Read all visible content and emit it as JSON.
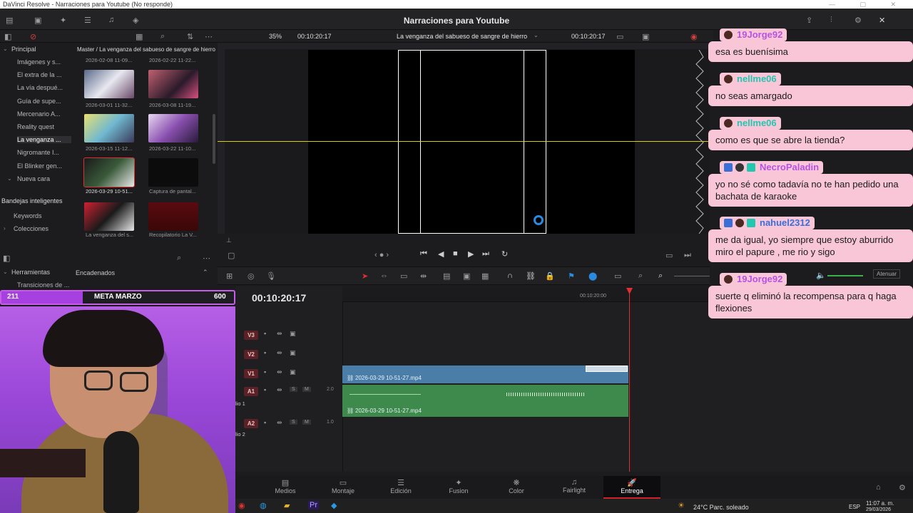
{
  "window": {
    "title": "DaVinci Resolve - Narraciones para Youtube (No responde)"
  },
  "appbar": {
    "project_title": "Narraciones para Youtube"
  },
  "viewer_bar": {
    "zoom": "35%",
    "timecode_left": "00:10:20:17",
    "clip_title": "La venganza del sabueso de sangre de hierro",
    "timecode_right": "00:10:20:17"
  },
  "sidebar": {
    "header": "Principal",
    "items": [
      {
        "label": "Imágenes y s..."
      },
      {
        "label": "El extra de la ..."
      },
      {
        "label": "La vía despué..."
      },
      {
        "label": "Guía de supe..."
      },
      {
        "label": "Mercenario A..."
      },
      {
        "label": "Reality quest"
      },
      {
        "label": "La venganza ..."
      },
      {
        "label": "Nigromante I..."
      },
      {
        "label": "El Blinker gen..."
      },
      {
        "label": "Nueva cara"
      }
    ],
    "smart_bins_header": "Bandejas inteligentes",
    "smart_bins": [
      {
        "label": "Keywords"
      },
      {
        "label": "Colecciones"
      }
    ]
  },
  "media_pool": {
    "path": "Master / La venganza del sabueso de sangre de hierro",
    "thumbnails": [
      {
        "caption": "2026-02-08 11-09..."
      },
      {
        "caption": "2026-02-22 11-22..."
      },
      {
        "caption": "2026-03-01 11-32..."
      },
      {
        "caption": "2026-03-08 11-19..."
      },
      {
        "caption": "2026-03-15 11-12..."
      },
      {
        "caption": "2026-03-22 11-10..."
      },
      {
        "caption": "2026-03-29 10-51..."
      },
      {
        "caption": "Captura de pantal..."
      },
      {
        "caption": "La venganza del s..."
      },
      {
        "caption": "Recopilatorio La V..."
      }
    ]
  },
  "lower_left": {
    "herramientas": "Herramientas",
    "transiciones": "Transiciones de ...",
    "encadenados": "Encadenados"
  },
  "goal": {
    "current": "211",
    "label": "META MARZO",
    "target": "600",
    "fraction": 0.35
  },
  "timeline": {
    "timecode": "00:10:20:17",
    "ruler_mark": "00:10:20:00",
    "tracks": [
      {
        "id": "V3"
      },
      {
        "id": "V2"
      },
      {
        "id": "V1"
      },
      {
        "id": "A1",
        "level": "2.0",
        "name": "lio 1"
      },
      {
        "id": "A2",
        "level": "1.0",
        "name": "lio 2"
      }
    ],
    "video_clip": "2026-03-29 10-51-27.mp4",
    "audio_clip": "2026-03-29 10-51-27.mp4",
    "attenuate_label": "Atenuar"
  },
  "pages": [
    {
      "label": "Medios",
      "icon": "media-icon"
    },
    {
      "label": "Montaje",
      "icon": "cut-icon"
    },
    {
      "label": "Edición",
      "icon": "edit-icon"
    },
    {
      "label": "Fusion",
      "icon": "fusion-icon"
    },
    {
      "label": "Color",
      "icon": "color-icon"
    },
    {
      "label": "Fairlight",
      "icon": "fairlight-icon"
    },
    {
      "label": "Entrega",
      "icon": "deliver-icon"
    }
  ],
  "taskbar": {
    "weather": "24°C Parc. soleado",
    "lang": "ESP",
    "time": "11:07 a. m.",
    "date": "29/03/2026"
  },
  "chat": [
    {
      "user": "19Jorge92",
      "user_color": "#b653e0",
      "message": "esa es buenísima"
    },
    {
      "user": "nellme06",
      "user_color": "#22c7b0",
      "message": "no seas amargado"
    },
    {
      "user": "nellme06",
      "user_color": "#22c7b0",
      "message": "como es que se abre la tienda?"
    },
    {
      "user": "NecroPaladin",
      "user_color": "#b653e0",
      "message": "yo no sé como tadavía no te han pedido una bachata de karaoke"
    },
    {
      "user": "nahuel2312",
      "user_color": "#3a6fd8",
      "message": "me da igual, yo siempre que estoy aburrido miro el papure , me rio y sigo"
    },
    {
      "user": "19Jorge92",
      "user_color": "#b653e0",
      "message": "suerte q eliminó la recompensa para q haga flexiones"
    }
  ],
  "colors": {
    "accent_red": "#d0202a",
    "video_clip": "#4a7ea8",
    "audio_clip": "#3d8a4c",
    "chat_bubble": "#f9c6d8",
    "goal_purple": "#a640e0"
  }
}
